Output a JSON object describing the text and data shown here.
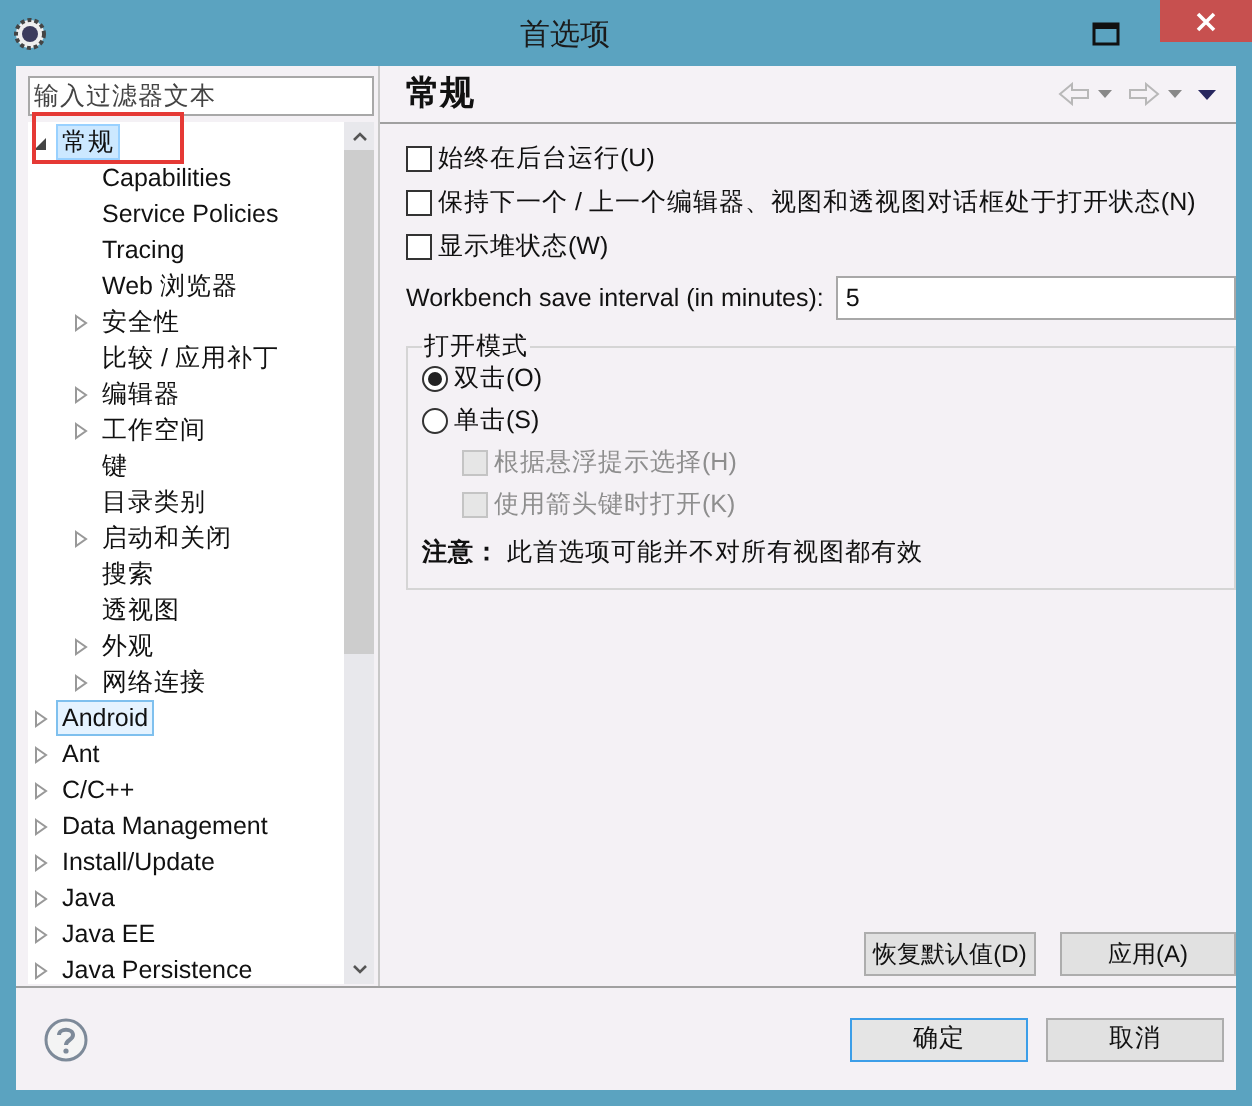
{
  "window": {
    "title": "首选项"
  },
  "filter": {
    "placeholder": "输入过滤器文本"
  },
  "annotation": {
    "kind": "outline"
  },
  "tree": [
    {
      "label": "常规",
      "expanded": true,
      "selected": true,
      "hovered": false,
      "children": [
        {
          "label": "Capabilities",
          "selected": false,
          "hovered": false
        },
        {
          "label": "Service Policies",
          "selected": false,
          "hovered": false
        },
        {
          "label": "Tracing",
          "selected": false,
          "hovered": false
        },
        {
          "label": "Web 浏览器",
          "selected": false,
          "hovered": false
        },
        {
          "label": "安全性",
          "expanded": false,
          "selected": false,
          "hovered": false
        },
        {
          "label": "比较 / 应用补丁",
          "selected": false,
          "hovered": false
        },
        {
          "label": "编辑器",
          "expanded": false,
          "selected": false,
          "hovered": false
        },
        {
          "label": "工作空间",
          "expanded": false,
          "selected": false,
          "hovered": false
        },
        {
          "label": "键",
          "selected": false,
          "hovered": false
        },
        {
          "label": "目录类别",
          "selected": false,
          "hovered": false
        },
        {
          "label": "启动和关闭",
          "expanded": false,
          "selected": false,
          "hovered": false
        },
        {
          "label": "搜索",
          "selected": false,
          "hovered": false
        },
        {
          "label": "透视图",
          "selected": false,
          "hovered": false
        },
        {
          "label": "外观",
          "expanded": false,
          "selected": false,
          "hovered": false
        },
        {
          "label": "网络连接",
          "expanded": false,
          "selected": false,
          "hovered": false
        }
      ]
    },
    {
      "label": "Android",
      "expanded": false,
      "selected": false,
      "hovered": true
    },
    {
      "label": "Ant",
      "expanded": false,
      "selected": false,
      "hovered": false
    },
    {
      "label": "C/C++",
      "expanded": false,
      "selected": false,
      "hovered": false
    },
    {
      "label": "Data Management",
      "expanded": false,
      "selected": false,
      "hovered": false
    },
    {
      "label": "Install/Update",
      "expanded": false,
      "selected": false,
      "hovered": false
    },
    {
      "label": "Java",
      "expanded": false,
      "selected": false,
      "hovered": false
    },
    {
      "label": "Java EE",
      "expanded": false,
      "selected": false,
      "hovered": false
    },
    {
      "label": "Java Persistence",
      "expanded": false,
      "selected": false,
      "hovered": false
    }
  ],
  "page": {
    "title": "常规",
    "options": [
      {
        "kind": "checkbox",
        "label": "始终在后台运行(U)",
        "checked": false,
        "disabled": false
      },
      {
        "kind": "checkbox",
        "label": "保持下一个 / 上一个编辑器、视图和透视图对话框处于打开状态(N)",
        "checked": false,
        "disabled": false
      },
      {
        "kind": "checkbox",
        "label": "显示堆状态(W)",
        "checked": false,
        "disabled": false
      }
    ],
    "save_interval": {
      "label": "Workbench save interval (in minutes):",
      "value": "5"
    },
    "open_mode": {
      "title": "打开模式",
      "items": [
        {
          "kind": "radio",
          "label": "双击(O)",
          "checked": true
        },
        {
          "kind": "radio",
          "label": "单击(S)",
          "checked": false
        },
        {
          "kind": "sub-checkbox",
          "label": "根据悬浮提示选择(H)",
          "checked": false,
          "disabled": true
        },
        {
          "kind": "sub-checkbox",
          "label": "使用箭头键时打开(K)",
          "checked": false,
          "disabled": true
        }
      ],
      "note": "**注意：** 此首选项可能并不对所有视图都有效"
    },
    "buttons": [
      "恢复默认值(D)",
      "应用(A)"
    ]
  },
  "dialog_buttons": [
    {
      "label": "确定",
      "selected": true
    },
    {
      "label": "取消",
      "selected": false
    }
  ]
}
